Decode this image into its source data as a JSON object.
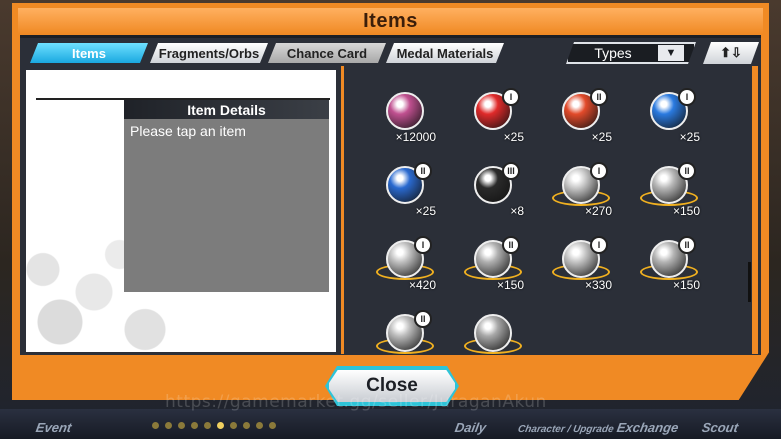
{
  "title": "Items",
  "tabs": [
    {
      "label": "Items",
      "state": "active"
    },
    {
      "label": "Fragments/Orbs",
      "state": "off"
    },
    {
      "label": "Chance Card",
      "state": "dim"
    },
    {
      "label": "Medal Materials",
      "state": "off"
    }
  ],
  "filter": {
    "types_label": "Types",
    "sort_label": "⬆⇩"
  },
  "details": {
    "header": "Item Details",
    "body": "Please tap an item"
  },
  "items": [
    {
      "icon": "coin-bag-icon",
      "qty": "×12000",
      "badge": "",
      "color": "#c05090"
    },
    {
      "icon": "red-orb-icon",
      "qty": "×25",
      "badge": "I",
      "color": "#e02a2a"
    },
    {
      "icon": "red-orb-icon",
      "qty": "×25",
      "badge": "II",
      "color": "#e24a2a"
    },
    {
      "icon": "blue-orb-icon",
      "qty": "×25",
      "badge": "I",
      "color": "#2a7ae0"
    },
    {
      "icon": "blue-orb-icon",
      "qty": "×25",
      "badge": "II",
      "color": "#2a6ad0"
    },
    {
      "icon": "black-orb-icon",
      "qty": "×8",
      "badge": "III",
      "color": "#2a2a2a"
    },
    {
      "icon": "heart-medal-icon",
      "qty": "×270",
      "badge": "I",
      "color": "#c8c8c8"
    },
    {
      "icon": "heart-medal-icon",
      "qty": "×150",
      "badge": "II",
      "color": "#b8b8b8"
    },
    {
      "icon": "sword-medal-icon",
      "qty": "×420",
      "badge": "I",
      "color": "#c0c0c0"
    },
    {
      "icon": "sword-medal-icon",
      "qty": "×150",
      "badge": "II",
      "color": "#b0b0b0"
    },
    {
      "icon": "gem-medal-icon",
      "qty": "×330",
      "badge": "I",
      "color": "#c4c4c4"
    },
    {
      "icon": "gem-medal-icon",
      "qty": "×150",
      "badge": "II",
      "color": "#b4b4b4"
    },
    {
      "icon": "skull-medal-icon",
      "qty": "",
      "badge": "II",
      "color": "#bcbcbc"
    },
    {
      "icon": "crystal-medal-icon",
      "qty": "",
      "badge": "",
      "color": "#a8a8a8"
    }
  ],
  "close_label": "Close",
  "bottom_nav": [
    "Event",
    "Daily",
    "Character / Upgrade",
    "Exchange",
    "Scout"
  ],
  "watermark": "https://gamemarket.gg/seller/JuraganAkun"
}
